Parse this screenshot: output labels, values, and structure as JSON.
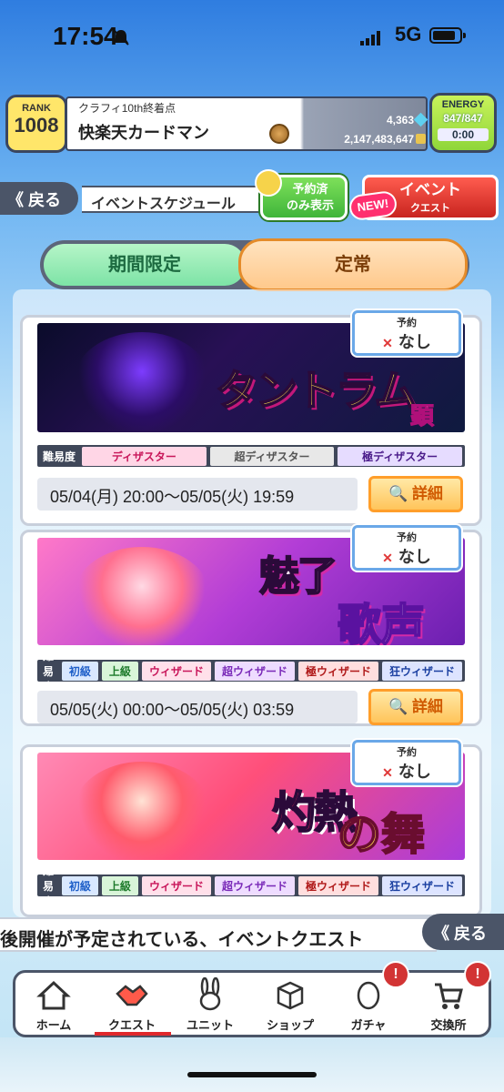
{
  "status_bar": {
    "time": "17:54",
    "network": "5G"
  },
  "header": {
    "rank_label": "RANK",
    "rank_value": "1008",
    "player_subtitle": "クラフィ10th終着点",
    "player_name": "快楽天カードマン",
    "gems": "4,363",
    "gold": "2,147,483,647",
    "energy_label": "ENERGY",
    "energy_value": "847/847",
    "energy_timer": "0:00"
  },
  "nav": {
    "back_label": "戻る",
    "page_title": "イベントスケジュール",
    "reserved_filter_label_1": "予約済",
    "reserved_filter_label_2": "のみ表示",
    "new_badge": "NEW!",
    "event_quest_label": "イベント",
    "event_quest_sub": "クエスト"
  },
  "tabs": [
    {
      "label": "期間限定",
      "active": false
    },
    {
      "label": "定常",
      "active": true
    }
  ],
  "events": [
    {
      "banner_title": "タントラム",
      "banner_subtitle": "顕現!",
      "reservation_header": "予約",
      "reservation_value": "なし",
      "difficulty_label": "難易度",
      "difficulties": [
        "ディザスター",
        "超ディザスター",
        "極ディザスター"
      ],
      "period": "05/04(月) 20:00～05/05(火) 19:59",
      "detail_label": "詳細"
    },
    {
      "banner_title": "魅了",
      "banner_subtitle": "歌声",
      "reservation_header": "予約",
      "reservation_value": "なし",
      "difficulty_label": "難易度",
      "difficulties": [
        "初級",
        "上級",
        "ウィザード",
        "超ウィザード",
        "極ウィザード",
        "狂ウィザード"
      ],
      "period": "05/05(火) 00:00～05/05(火) 03:59",
      "detail_label": "詳細"
    },
    {
      "banner_title": "灼熱",
      "banner_subtitle": "の舞姫",
      "reservation_header": "予約",
      "reservation_value": "なし",
      "difficulty_label": "難易度",
      "difficulties": [
        "初級",
        "上級",
        "ウィザード",
        "超ウィザード",
        "極ウィザード",
        "狂ウィザード"
      ],
      "period": "",
      "detail_label": ""
    }
  ],
  "ticker": {
    "text": "後開催が予定されている、イベントクエスト"
  },
  "back2_label": "戻る",
  "bottom_tabs": [
    {
      "label": "ホーム",
      "icon": "home-icon"
    },
    {
      "label": "クエスト",
      "icon": "handshake-icon"
    },
    {
      "label": "ユニット",
      "icon": "rabbit-icon"
    },
    {
      "label": "ショップ",
      "icon": "box-icon"
    },
    {
      "label": "ガチャ",
      "icon": "egg-icon"
    },
    {
      "label": "交換所",
      "icon": "cart-icon"
    }
  ],
  "colors": {
    "accent_red": "#e0282c",
    "tab_green": "#7de3a6",
    "tab_orange": "#ffc98c"
  }
}
